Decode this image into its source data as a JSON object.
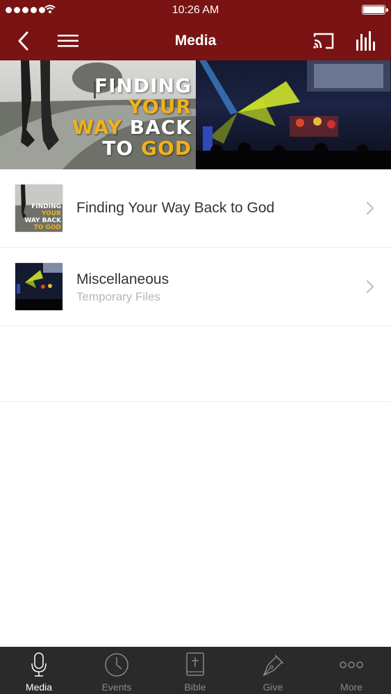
{
  "status_bar": {
    "time": "10:26 AM"
  },
  "nav": {
    "title": "Media",
    "icons": [
      "back-icon",
      "menu-icon",
      "cast-icon",
      "equalizer-icon"
    ]
  },
  "banner": {
    "title_lines": [
      "FINDING",
      "YOUR",
      "WAY BACK",
      "TO GOD"
    ]
  },
  "list": [
    {
      "title": "Finding Your Way Back to God",
      "subtitle": ""
    },
    {
      "title": "Miscellaneous",
      "subtitle": "Temporary Files"
    }
  ],
  "tabs": [
    {
      "label": "Media",
      "icon": "microphone-icon",
      "active": true
    },
    {
      "label": "Events",
      "icon": "clock-icon",
      "active": false
    },
    {
      "label": "Bible",
      "icon": "bible-icon",
      "active": false
    },
    {
      "label": "Give",
      "icon": "pen-nib-icon",
      "active": false
    },
    {
      "label": "More",
      "icon": "more-icon",
      "active": false
    }
  ],
  "colors": {
    "brand": "#7a1313",
    "tabbar": "#2a2a2a",
    "accent_yellow": "#f0b21a"
  }
}
